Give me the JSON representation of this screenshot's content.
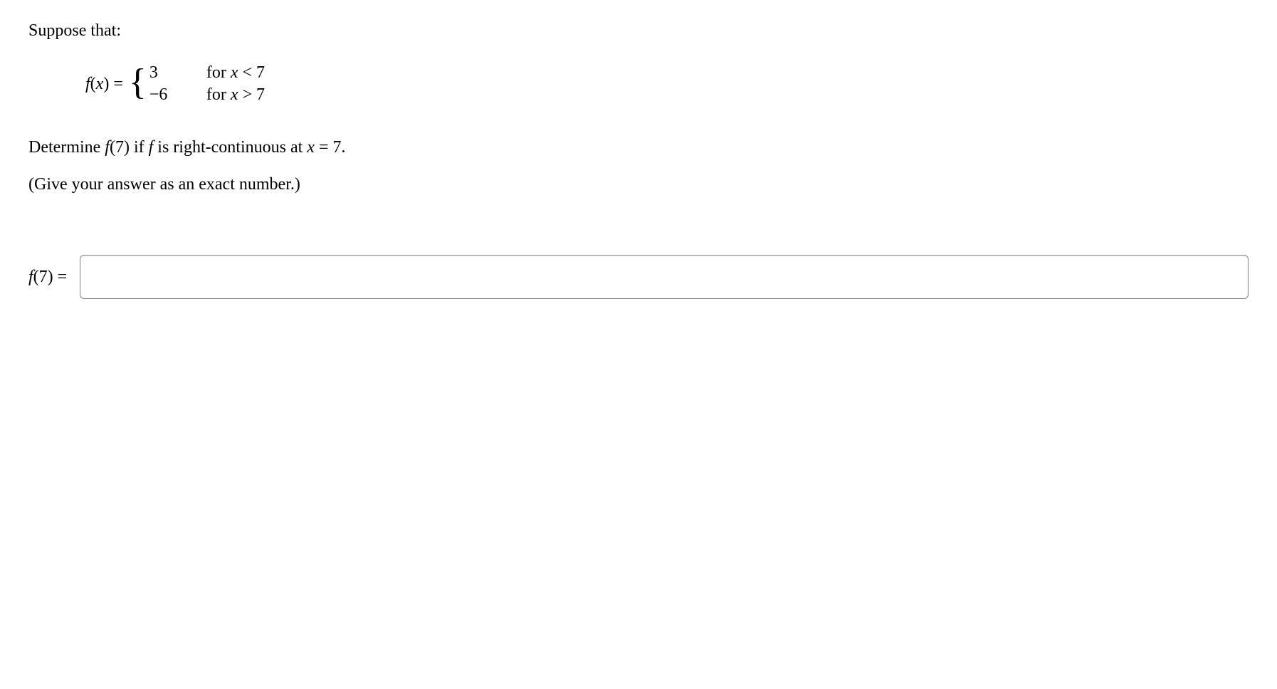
{
  "intro": "Suppose that:",
  "function": {
    "label_f": "f",
    "label_x": "x",
    "equals": " = ",
    "cases": [
      {
        "value": "3",
        "condition_prefix": "for ",
        "condition_var": "x",
        "condition_rest": " < 7"
      },
      {
        "value": "−6",
        "condition_prefix": "for ",
        "condition_var": "x",
        "condition_rest": " > 7"
      }
    ]
  },
  "question": {
    "prefix": "Determine ",
    "f": "f",
    "arg": "(7)",
    "mid": " if ",
    "f2": "f",
    "rest1": " is right-continuous at ",
    "var": "x",
    "rest2": " = 7."
  },
  "instruction": "(Give your answer as an exact number.)",
  "answer": {
    "f": "f",
    "arg": "(7) = ",
    "value": ""
  }
}
